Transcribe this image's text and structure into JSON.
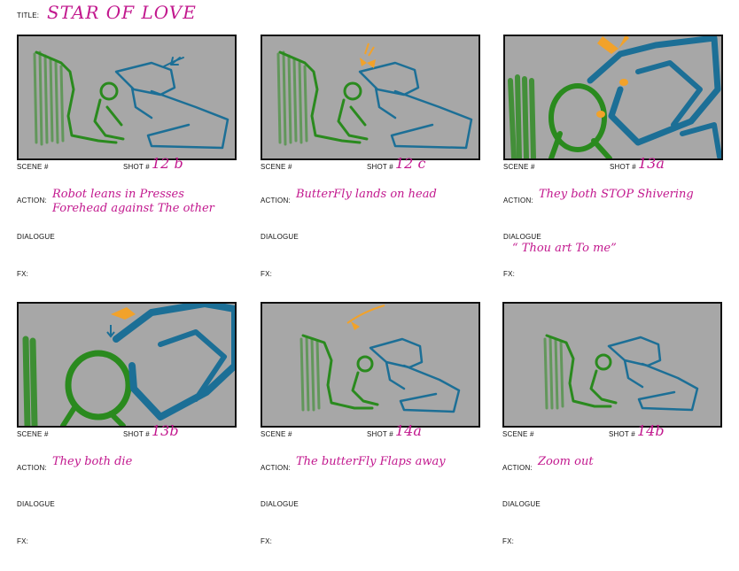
{
  "title": {
    "label": "TITLE:",
    "value": "STAR OF LOVE"
  },
  "field_labels": {
    "scene": "SCENE #",
    "shot": "SHOT #",
    "action": "ACTION:",
    "dialogue": "DIALOGUE",
    "fx": "FX:"
  },
  "panels": [
    {
      "shot": "12 b",
      "action": "Robot leans in Presses Forehead against The other",
      "dialogue": ""
    },
    {
      "shot": "12 c",
      "action": "ButterFly lands on head",
      "dialogue": ""
    },
    {
      "shot": "13a",
      "action": "They both STOP Shivering",
      "dialogue": "“ Thou art To me”"
    },
    {
      "shot": "13b",
      "action": "They both die",
      "dialogue": ""
    },
    {
      "shot": "14a",
      "action": "The butterFly Flaps away",
      "dialogue": ""
    },
    {
      "shot": "14b",
      "action": "Zoom out",
      "dialogue": ""
    }
  ],
  "colors": {
    "frame_bg": "#a7a7a7",
    "green_figure": "#2a8a1e",
    "blue_robot": "#1c6f96",
    "butterfly": "#f2a22a",
    "handwriting": "#c2188e"
  },
  "icons": [
    "butterfly-icon",
    "down-arrow-icon"
  ]
}
